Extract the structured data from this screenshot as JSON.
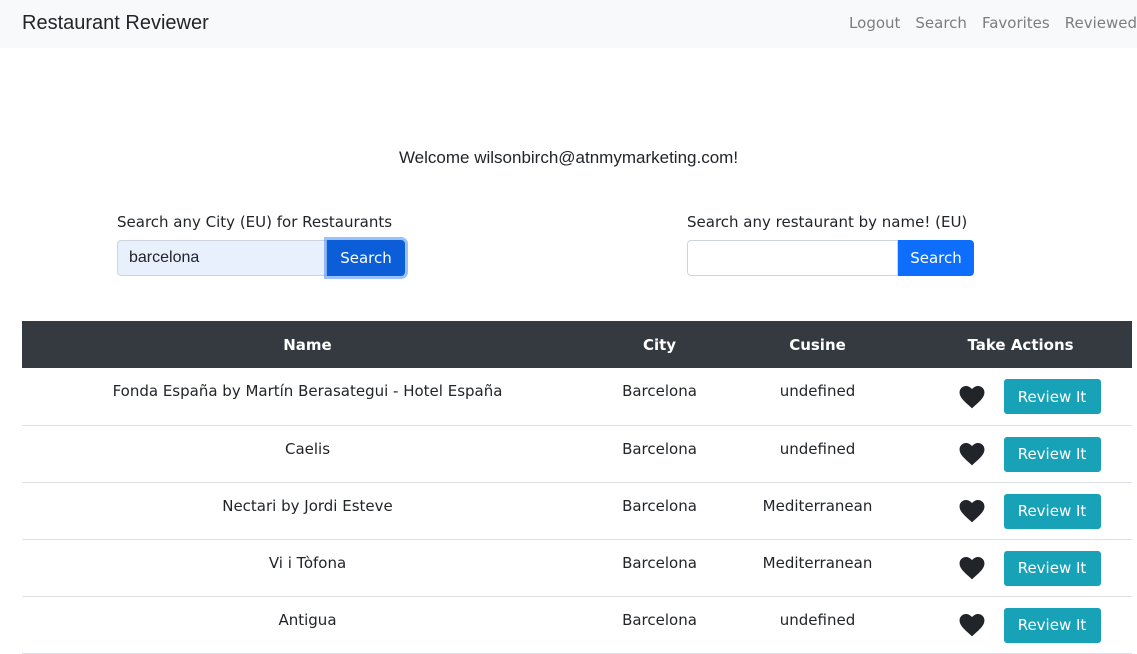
{
  "app": {
    "brand": "Restaurant Reviewer"
  },
  "nav": {
    "items": [
      "Logout",
      "Search",
      "Favorites",
      "Reviewed"
    ]
  },
  "welcome": "Welcome wilsonbirch@atnmymarketing.com!",
  "city_search": {
    "label": "Search any City (EU) for Restaurants",
    "value": "barcelona",
    "button": "Search"
  },
  "name_search": {
    "label": "Search any restaurant by name! (EU)",
    "value": "",
    "button": "Search"
  },
  "table": {
    "headers": [
      "Name",
      "City",
      "Cusine",
      "Take Actions"
    ],
    "rows": [
      {
        "name": "Fonda España by Martín Berasategui - Hotel España",
        "city": "Barcelona",
        "cuisine": "undefined",
        "action": "Review It"
      },
      {
        "name": "Caelis",
        "city": "Barcelona",
        "cuisine": "undefined",
        "action": "Review It"
      },
      {
        "name": "Nectari by Jordi Esteve",
        "city": "Barcelona",
        "cuisine": "Mediterranean",
        "action": "Review It"
      },
      {
        "name": "Vi i Tòfona",
        "city": "Barcelona",
        "cuisine": "Mediterranean",
        "action": "Review It"
      },
      {
        "name": "Antigua",
        "city": "Barcelona",
        "cuisine": "undefined",
        "action": "Review It"
      }
    ]
  },
  "icons": {
    "favorite": "heart-icon"
  },
  "colors": {
    "primary": "#0d6efd",
    "info": "#17a2b8",
    "table_header": "#343a40",
    "navbar": "#f8f9fa"
  }
}
